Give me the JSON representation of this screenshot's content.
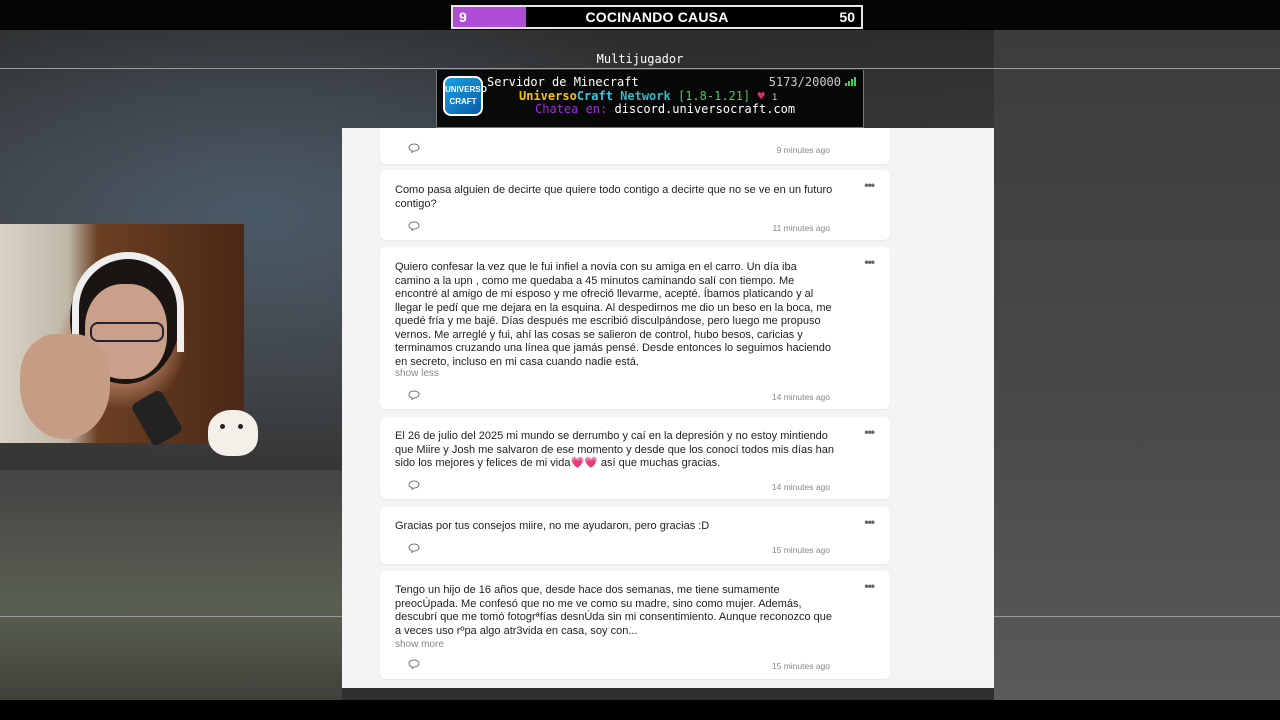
{
  "goal_bar": {
    "current": "9",
    "title": "COCINANDO CAUSA",
    "target": "50",
    "fill_fraction": 0.18,
    "fill_color": "#b04dd6"
  },
  "minecraft": {
    "screen_title": "Multijugador",
    "server": {
      "logo_text": "UNIVERSO CRAFT",
      "name": "Servidor de Minecraft",
      "count": "5173/20000",
      "motd_brand_a": "Universo",
      "motd_brand_b": "Craft",
      "motd_network": "Network",
      "motd_version": "[1.8-1.21]",
      "motd_badge": "1",
      "motd_chat_label": "Chatea en:",
      "motd_chat_url": "discord.universocraft.com"
    }
  },
  "feed": {
    "posts": [
      {
        "text": "",
        "more": "",
        "time": "9 minutes ago"
      },
      {
        "text": "Como pasa alguien de decirte que quiere todo contigo a decirte que no se ve en un futuro contigo?",
        "more": "",
        "time": "11 minutes ago"
      },
      {
        "text": "Quiero confesar la vez que le fui infiel a novia con su amiga en el carro. Un día iba camino a la upn , como me quedaba a 45 minutos caminando salí con tiempo. Me encontré al amigo de mi esposo y me ofreció llevarme, acepté. Íbamos platicando y al llegar le pedí que me dejara en la esquina. Al despedirnos me dio un beso en la boca, me quedé fría y me bajé. Días después me escribió disculpándose, pero luego me propuso vernos. Me arreglé y fui, ahí las cosas se salieron de control, hubo besos, caricias y terminamos cruzando una línea que jamás pensé. Desde entonces lo seguimos haciendo en secreto, incluso en mi casa cuando nadie está.",
        "more": "show less",
        "time": "14 minutes ago"
      },
      {
        "text": "El 26 de julio del 2025 mi mundo se derrumbo y caí en la depresión y no estoy mintiendo que Miire y Josh me salvaron de ese momento y desde que los conocí todos mis días han sido los mejores y felices de mi vida💗💗 así que muchas gracias.",
        "more": "",
        "time": "14 minutes ago"
      },
      {
        "text": "Gracias por tus consejos miire, no me ayudaron, pero gracias :D",
        "more": "",
        "time": "15 minutes ago"
      },
      {
        "text": "Tengo un hijo de 16 años que, desde hace dos semanas, me tiene sumamente preocÚpada. Me confesó que no me ve como su madre, sino como mujer. Además, descubrí que me tomó fotogrªfías desnÚda sin mi consentimiento. Aunque reconozco que a veces uso rºpa algo atr3vida en casa, soy con...",
        "more": "show more",
        "time": "15 minutes ago"
      }
    ],
    "menu_icon": "ellipsis-icon",
    "comment_icon": "comment-icon"
  }
}
